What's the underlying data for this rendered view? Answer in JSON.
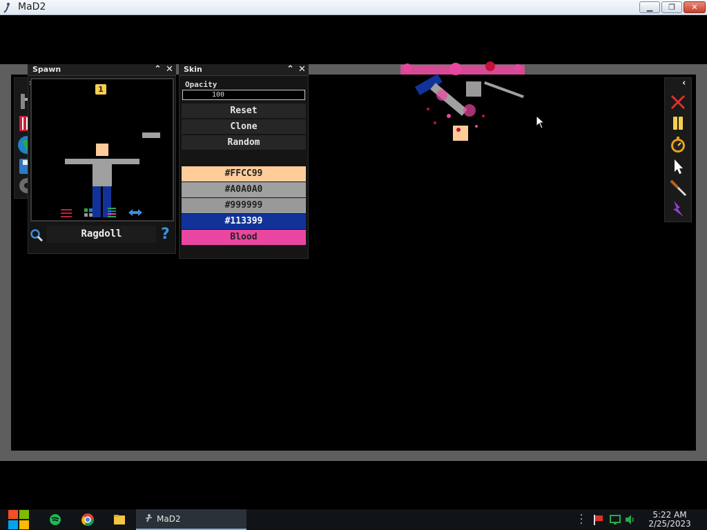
{
  "window": {
    "title": "MaD2"
  },
  "spawn_panel": {
    "title": "Spawn",
    "page_number": "1",
    "selected_item": "Ragdoll"
  },
  "skin_panel": {
    "title": "Skin",
    "opacity_label": "Opacity",
    "opacity_value": "100",
    "buttons": [
      "Reset",
      "Clone",
      "Random"
    ],
    "swatches": [
      {
        "label": "#FFCC99",
        "color": "#FFCC99",
        "text_color": "#222222"
      },
      {
        "label": "#A0A0A0",
        "color": "#A0A0A0",
        "text_color": "#222222"
      },
      {
        "label": "#999999",
        "color": "#999999",
        "text_color": "#222222"
      },
      {
        "label": "#113399",
        "color": "#113399",
        "text_color": "#FFFFFF"
      },
      {
        "label": "Blood",
        "color": "#E9479F",
        "text_color": "#222222"
      }
    ]
  },
  "right_toolbar": {
    "tools": [
      "close-x-icon",
      "pause-icon",
      "stopwatch-icon",
      "cursor-icon",
      "knife-icon",
      "lightning-icon"
    ]
  },
  "taskbar": {
    "task_label": "MaD2",
    "time": "5:22 AM",
    "date": "2/25/2023"
  }
}
